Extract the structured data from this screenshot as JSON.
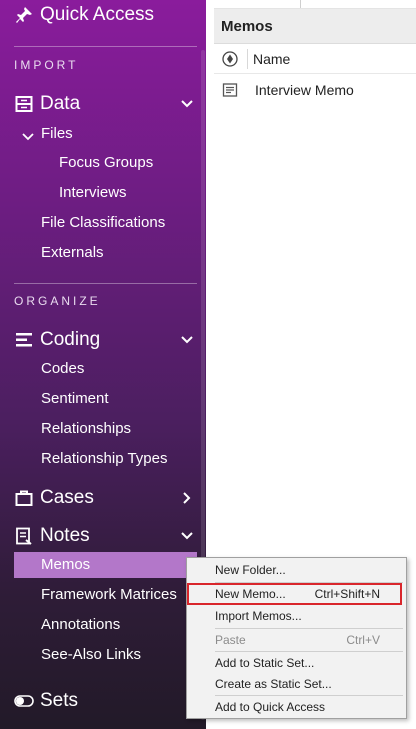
{
  "sidebar": {
    "quick_access": "Quick Access",
    "groups": {
      "import": "IMPORT",
      "organize": "ORGANIZE"
    },
    "data": {
      "label": "Data",
      "files": "Files",
      "focus_groups": "Focus Groups",
      "interviews": "Interviews",
      "file_classifications": "File Classifications",
      "externals": "Externals"
    },
    "coding": {
      "label": "Coding",
      "codes": "Codes",
      "sentiment": "Sentiment",
      "relationships": "Relationships",
      "relationship_types": "Relationship Types"
    },
    "cases": {
      "label": "Cases"
    },
    "notes": {
      "label": "Notes",
      "memos": "Memos",
      "framework_matrices": "Framework Matrices",
      "annotations": "Annotations",
      "see_also_links": "See-Also Links"
    },
    "sets": {
      "label": "Sets"
    }
  },
  "main": {
    "title": "Memos",
    "column_name": "Name",
    "rows": [
      {
        "name": "Interview Memo"
      }
    ]
  },
  "context_menu": {
    "new_folder": "New Folder...",
    "new_memo": "New Memo...",
    "new_memo_shortcut": "Ctrl+Shift+N",
    "import_memos": "Import Memos...",
    "paste": "Paste",
    "paste_shortcut": "Ctrl+V",
    "add_to_static_set": "Add to Static Set...",
    "create_as_static_set": "Create as Static Set...",
    "add_to_quick_access": "Add to Quick Access"
  },
  "colors": {
    "sidebar_top": "#8a1c9c",
    "sidebar_bottom": "#221a28",
    "selection": "#b377c9",
    "highlight_border": "#d9262c"
  },
  "icons": {
    "quick_access": "pin-icon",
    "data": "database-icon",
    "coding": "coding-lines-icon",
    "cases": "briefcase-icon",
    "notes": "notes-icon",
    "sets": "toggle-icon",
    "memo": "memo-document-icon"
  }
}
